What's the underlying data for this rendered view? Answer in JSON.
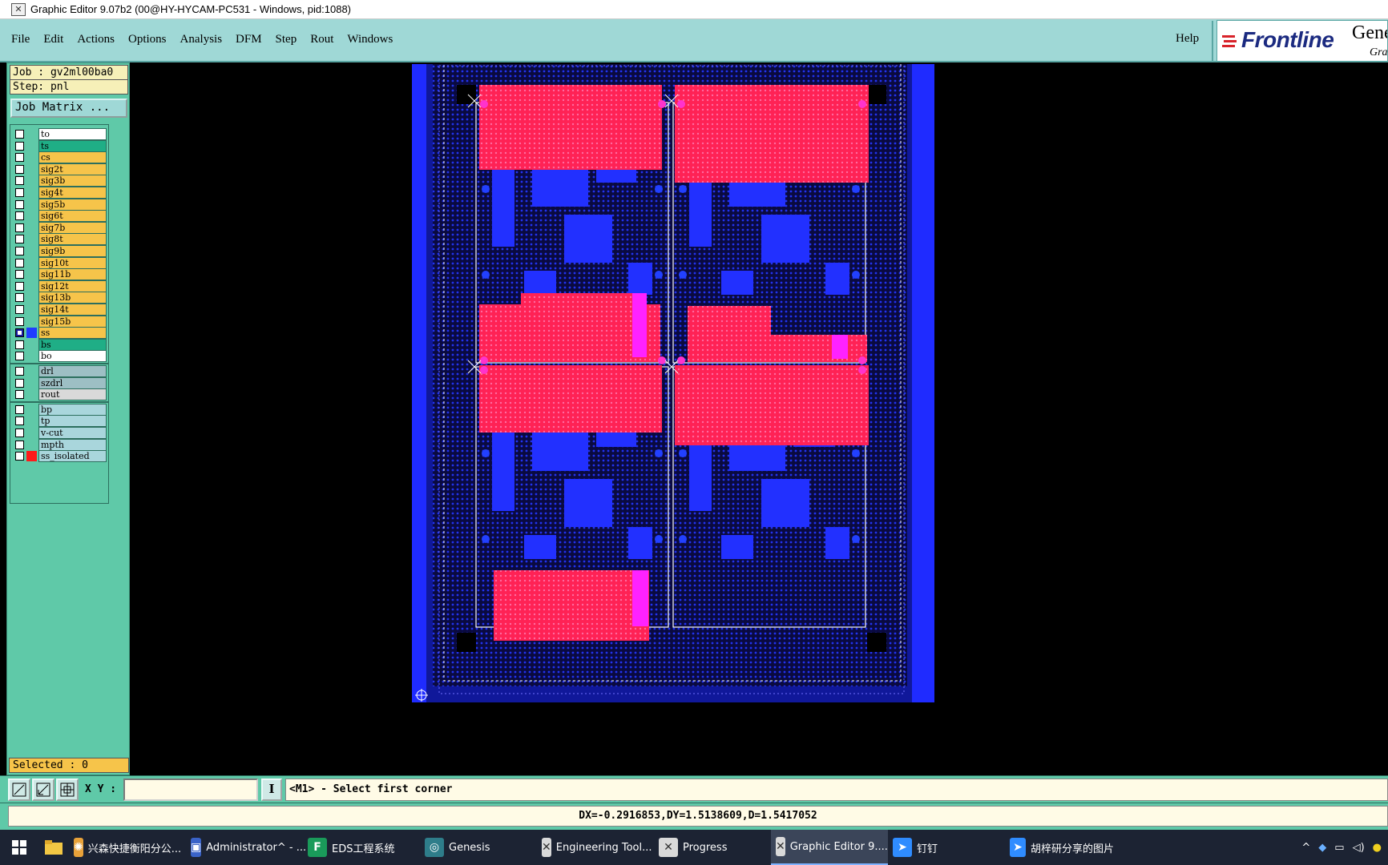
{
  "window": {
    "title": "Graphic Editor 9.07b2 (00@HY-HYCAM-PC531 - Windows, pid:1088)"
  },
  "menu": {
    "items": [
      "File",
      "Edit",
      "Actions",
      "Options",
      "Analysis",
      "DFM",
      "Step",
      "Rout",
      "Windows"
    ],
    "help": "Help"
  },
  "brand": {
    "logo_text": "Frontline",
    "product_cut": "Gene",
    "subtitle_cut": "Gra"
  },
  "panel": {
    "job": "Job : gv2ml00ba0",
    "step": "Step: pnl",
    "job_matrix_label": "Job Matrix ...",
    "selected": "Selected : 0"
  },
  "layers": [
    {
      "name": "to",
      "color": "#ffffff",
      "swatch": "",
      "checked": false,
      "mark": ""
    },
    {
      "name": "ts",
      "color": "#1fae86",
      "swatch": "",
      "checked": false,
      "mark": ""
    },
    {
      "name": "cs",
      "color": "#f6c44a",
      "swatch": "",
      "checked": false,
      "mark": ""
    },
    {
      "name": "sig2t",
      "color": "#f6c44a",
      "swatch": "",
      "checked": false,
      "mark": ""
    },
    {
      "name": "sig3b",
      "color": "#f6c44a",
      "swatch": "",
      "checked": false,
      "mark": ""
    },
    {
      "name": "sig4t",
      "color": "#f6c44a",
      "swatch": "",
      "checked": false,
      "mark": ""
    },
    {
      "name": "sig5b",
      "color": "#f6c44a",
      "swatch": "",
      "checked": false,
      "mark": ""
    },
    {
      "name": "sig6t",
      "color": "#f6c44a",
      "swatch": "",
      "checked": false,
      "mark": ""
    },
    {
      "name": "sig7b",
      "color": "#f6c44a",
      "swatch": "",
      "checked": false,
      "mark": ""
    },
    {
      "name": "sig8t",
      "color": "#f6c44a",
      "swatch": "",
      "checked": false,
      "mark": ""
    },
    {
      "name": "sig9b",
      "color": "#f6c44a",
      "swatch": "",
      "checked": false,
      "mark": ""
    },
    {
      "name": "sig10t",
      "color": "#f6c44a",
      "swatch": "",
      "checked": false,
      "mark": ""
    },
    {
      "name": "sig11b",
      "color": "#f6c44a",
      "swatch": "",
      "checked": false,
      "mark": ""
    },
    {
      "name": "sig12t",
      "color": "#f6c44a",
      "swatch": "",
      "checked": false,
      "mark": ""
    },
    {
      "name": "sig13b",
      "color": "#f6c44a",
      "swatch": "",
      "checked": false,
      "mark": ""
    },
    {
      "name": "sig14t",
      "color": "#f6c44a",
      "swatch": "",
      "checked": false,
      "mark": ""
    },
    {
      "name": "sig15b",
      "color": "#f6c44a",
      "swatch": "",
      "checked": false,
      "mark": ""
    },
    {
      "name": "ss",
      "color": "#f6c44a",
      "swatch": "#1f3cff",
      "checked": true,
      "mark": "m"
    },
    {
      "name": "bs",
      "color": "#1fae86",
      "swatch": "",
      "checked": false,
      "mark": ""
    },
    {
      "name": "bo",
      "color": "#ffffff",
      "swatch": "",
      "checked": false,
      "mark": ""
    },
    {
      "name": "drl",
      "color": "#9dbfc4",
      "swatch": "",
      "checked": false,
      "mark": ""
    },
    {
      "name": "szdrl",
      "color": "#9dbfc4",
      "swatch": "",
      "checked": false,
      "mark": ""
    },
    {
      "name": "rout",
      "color": "#d9d9d9",
      "swatch": "",
      "checked": false,
      "mark": ""
    },
    {
      "name": "bp",
      "color": "#a9d6dc",
      "swatch": "",
      "checked": false,
      "mark": ""
    },
    {
      "name": "tp",
      "color": "#a9d6dc",
      "swatch": "",
      "checked": false,
      "mark": ""
    },
    {
      "name": "v-cut",
      "color": "#a9d6dc",
      "swatch": "",
      "checked": false,
      "mark": ""
    },
    {
      "name": "mpth",
      "color": "#a9d6dc",
      "swatch": "",
      "checked": false,
      "mark": ""
    },
    {
      "name": "ss_isolated",
      "color": "#a9d6dc",
      "swatch": "#ff1a1a",
      "checked": false,
      "mark": ""
    }
  ],
  "colors": {
    "panel_bg": "#5fc9a8",
    "menu_bg": "#9fd8d6",
    "board_blue": "#1f2bff",
    "board_red": "#ff2255",
    "board_magenta": "#ff22ff"
  },
  "command": {
    "xy_label": "X Y :",
    "xy_value": "",
    "info_label": "I",
    "prompt": "<M1> - Select first corner"
  },
  "status": {
    "coords": "DX=-0.2916853,DY=1.5138609,D=1.5417052"
  },
  "taskbar": {
    "items": [
      {
        "label": "兴森快捷衡阳分公...",
        "icon": "pinwheel-icon",
        "active": false
      },
      {
        "label": "Administrator^ - ...",
        "icon": "floppy-disk-icon",
        "active": false
      },
      {
        "label": "EDS工程系统",
        "icon": "eds-f-icon",
        "active": false
      },
      {
        "label": "Genesis",
        "icon": "genesis-icon",
        "active": false
      },
      {
        "label": "Engineering Tool...",
        "icon": "editor-x-icon",
        "active": false
      },
      {
        "label": "Progress",
        "icon": "editor-x-icon",
        "active": false
      },
      {
        "label": "Graphic Editor 9....",
        "icon": "editor-x-icon",
        "active": true
      },
      {
        "label": "钉钉",
        "icon": "dingtalk-icon",
        "active": false
      },
      {
        "label": "胡梓研分享的图片",
        "icon": "dingtalk-icon",
        "active": false
      }
    ]
  }
}
